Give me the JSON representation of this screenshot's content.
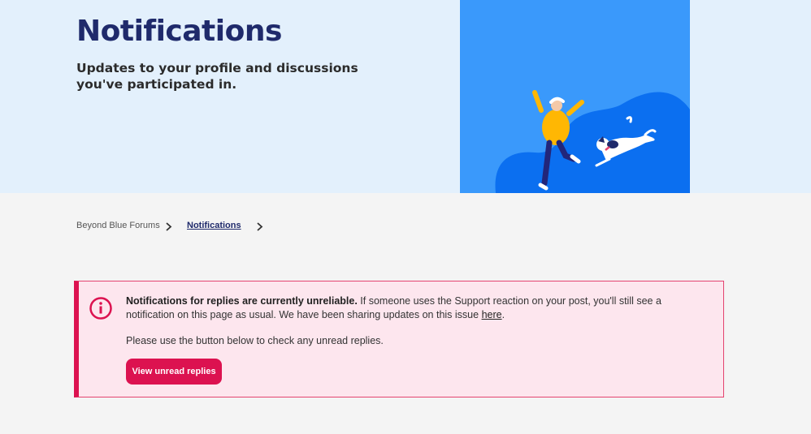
{
  "hero": {
    "title": "Notifications",
    "subtitle": "Updates to your profile and discussions you've participated in.",
    "illustration_bg": "#3a99fb"
  },
  "breadcrumb": {
    "items": [
      "Beyond Blue Forums",
      "Notifications"
    ]
  },
  "alert": {
    "bold_text": "Notifications for replies are currently unreliable.",
    "body_text": " If someone uses the Support reaction on your post, you'll still see a notification on this page as usual. We have been sharing updates on this issue ",
    "link_text": "here",
    "after_link": ".",
    "second_paragraph": "Please use the button below to check any unread replies.",
    "button_label": "View unread replies",
    "accent_color": "#dc1250",
    "icon": "info-icon"
  }
}
